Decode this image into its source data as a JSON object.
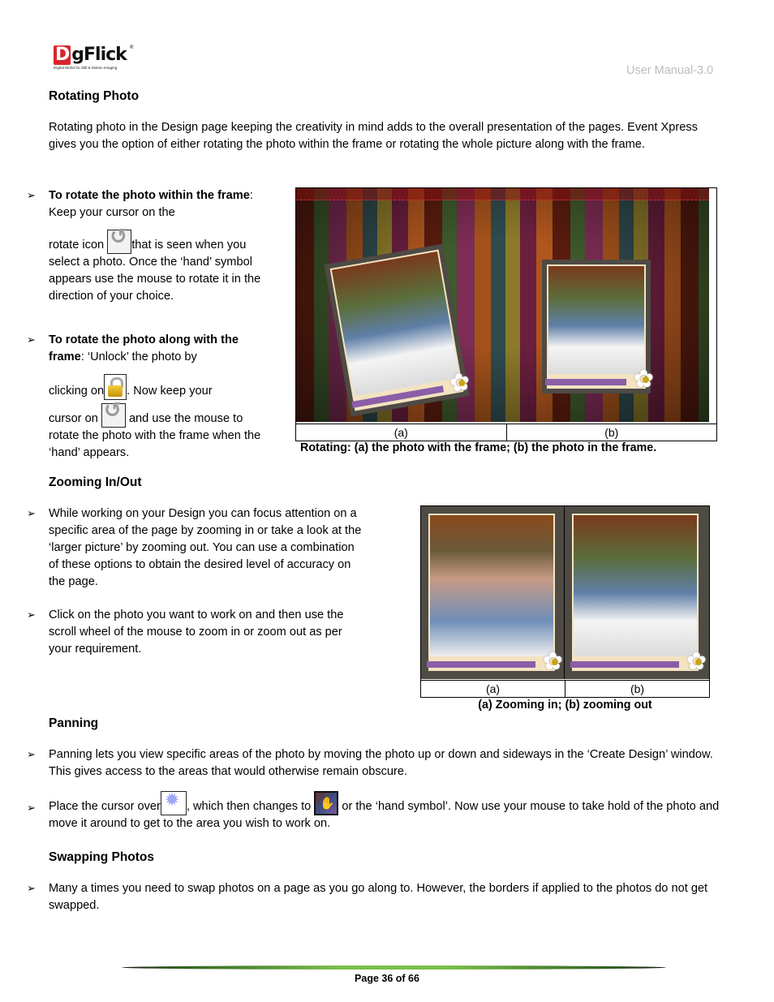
{
  "header": {
    "logo_text": "DgFlick",
    "logo_letter": "D",
    "logo_rest": "gFlick",
    "logo_registered": "®",
    "logo_tagline": "Digital World for Still & Motion Imaging",
    "manual_version": "User Manual-3.0"
  },
  "sections": {
    "rotating": {
      "heading": "Rotating Photo",
      "intro": "Rotating photo in the Design page keeping the creativity in mind adds to the overall presentation of the pages. Event Xpress gives you the option of either rotating the photo within the frame or rotating the whole picture along with the frame.",
      "bullet1": {
        "bold": "To rotate the photo within the frame",
        "line1_rest": ": Keep your cursor on the",
        "before_icon": "rotate icon ",
        "after_icon": "that is seen when",
        "rest": "you select a photo. Once the ‘hand’ symbol appears use the mouse to rotate it in the direction of your choice."
      },
      "bullet2": {
        "bold": "To rotate the photo along with the frame",
        "line1_rest": ": ‘Unlock’ the photo by",
        "before_lock": "clicking on",
        "after_lock": ". Now keep your",
        "before_rotate": "cursor on ",
        "after_rotate": " and use the mouse",
        "rest": "to rotate the photo with the frame when the ‘hand’ appears."
      },
      "figure": {
        "label_a": "(a)",
        "label_b": "(b)",
        "caption": "Rotating: (a) the photo with the frame; (b) the photo in the frame."
      }
    },
    "zooming": {
      "heading": "Zooming In/Out",
      "bullet1": "While working on your Design you can focus attention on a specific area of the page by zooming in or take a look at the ‘larger picture’ by zooming out. You can use a combination of these options to obtain the desired level of accuracy on the page.",
      "bullet2": "Click on the photo you want to work on and then use the scroll wheel of the mouse to zoom in or zoom out as per your requirement.",
      "figure": {
        "label_a": "(a)",
        "label_b": "(b)",
        "caption": "(a) Zooming in; (b) zooming out"
      }
    },
    "panning": {
      "heading": "Panning",
      "bullet1": "Panning lets you view specific areas of the photo by moving the photo up or down and sideways in the ‘Create Design’ window. This gives access to the areas that would otherwise remain obscure.",
      "bullet2_before_sun": "Place the cursor over",
      "bullet2_between": ", which then changes to ",
      "bullet2_after_hand": " or the ‘hand symbol’. Now use your mouse to take hold of the photo and move it around to get to the area you wish to work on."
    },
    "swapping": {
      "heading": "Swapping Photos",
      "bullet1": "Many a times you need to swap photos on a page as you go along to. However, the borders if applied to the photos do not get swapped."
    }
  },
  "bullet_glyph": "➢",
  "icons": {
    "rotate": "rotate-icon",
    "lock": "lock-icon",
    "pan": "sun-pan-icon",
    "hand": "hand-icon"
  },
  "footer": {
    "page_label": "Page 36 of 66"
  }
}
